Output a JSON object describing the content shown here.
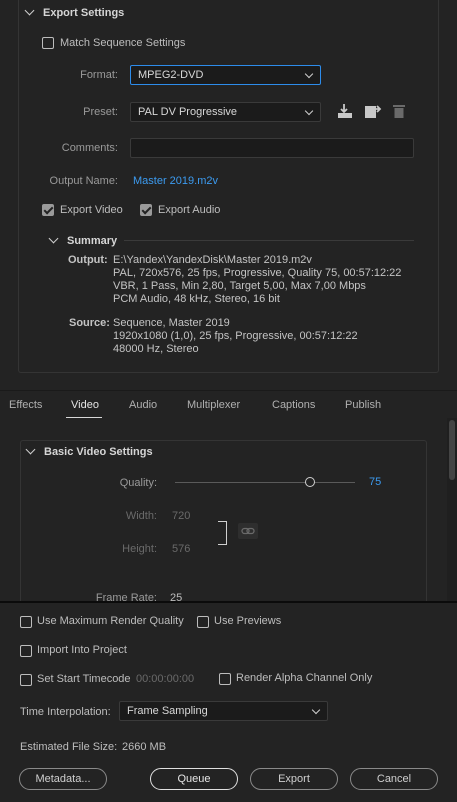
{
  "export_settings": {
    "header": "Export Settings",
    "match_sequence": {
      "label": "Match Sequence Settings",
      "checked": false
    },
    "format": {
      "label": "Format:",
      "value": "MPEG2-DVD"
    },
    "preset": {
      "label": "Preset:",
      "value": "PAL DV Progressive"
    },
    "comments": {
      "label": "Comments:",
      "value": ""
    },
    "output_name": {
      "label": "Output Name:",
      "value": "Master 2019.m2v"
    },
    "export_video": {
      "label": "Export Video",
      "checked": true
    },
    "export_audio": {
      "label": "Export Audio",
      "checked": true
    },
    "summary": {
      "header": "Summary",
      "output_label": "Output:",
      "output_lines": [
        "E:\\Yandex\\YandexDisk\\Master 2019.m2v",
        "PAL, 720x576, 25 fps, Progressive, Quality 75, 00:57:12:22",
        "VBR, 1 Pass, Min 2,80, Target 5,00, Max 7,00 Mbps",
        "PCM Audio, 48 kHz, Stereo, 16 bit"
      ],
      "source_label": "Source:",
      "source_lines": [
        "Sequence, Master 2019",
        "1920x1080 (1,0), 25 fps, Progressive, 00:57:12:22",
        "48000 Hz, Stereo"
      ]
    }
  },
  "tabs": [
    "Effects",
    "Video",
    "Audio",
    "Multiplexer",
    "Captions",
    "Publish"
  ],
  "active_tab": "Video",
  "video": {
    "header": "Basic Video Settings",
    "quality": {
      "label": "Quality:",
      "value": "75",
      "fraction": 0.75
    },
    "width": {
      "label": "Width:",
      "value": "720"
    },
    "height": {
      "label": "Height:",
      "value": "576"
    },
    "frame_rate": {
      "label": "Frame Rate:",
      "value": "25"
    }
  },
  "bottom": {
    "max_render_quality": {
      "label": "Use Maximum Render Quality",
      "checked": false
    },
    "use_previews": {
      "label": "Use Previews",
      "checked": false
    },
    "import_into_project": {
      "label": "Import Into Project",
      "checked": false
    },
    "set_start_timecode": {
      "label": "Set Start Timecode",
      "checked": false,
      "value": "00:00:00:00"
    },
    "render_alpha": {
      "label": "Render Alpha Channel Only",
      "checked": false
    },
    "time_interpolation": {
      "label": "Time Interpolation:",
      "value": "Frame Sampling"
    },
    "file_size": {
      "label": "Estimated File Size:",
      "value": "2660 MB"
    },
    "buttons": {
      "metadata": "Metadata...",
      "queue": "Queue",
      "export": "Export",
      "cancel": "Cancel"
    }
  },
  "colors": {
    "accent": "#3c9bf0",
    "background": "#232323",
    "focus": "#2d8ceb"
  }
}
